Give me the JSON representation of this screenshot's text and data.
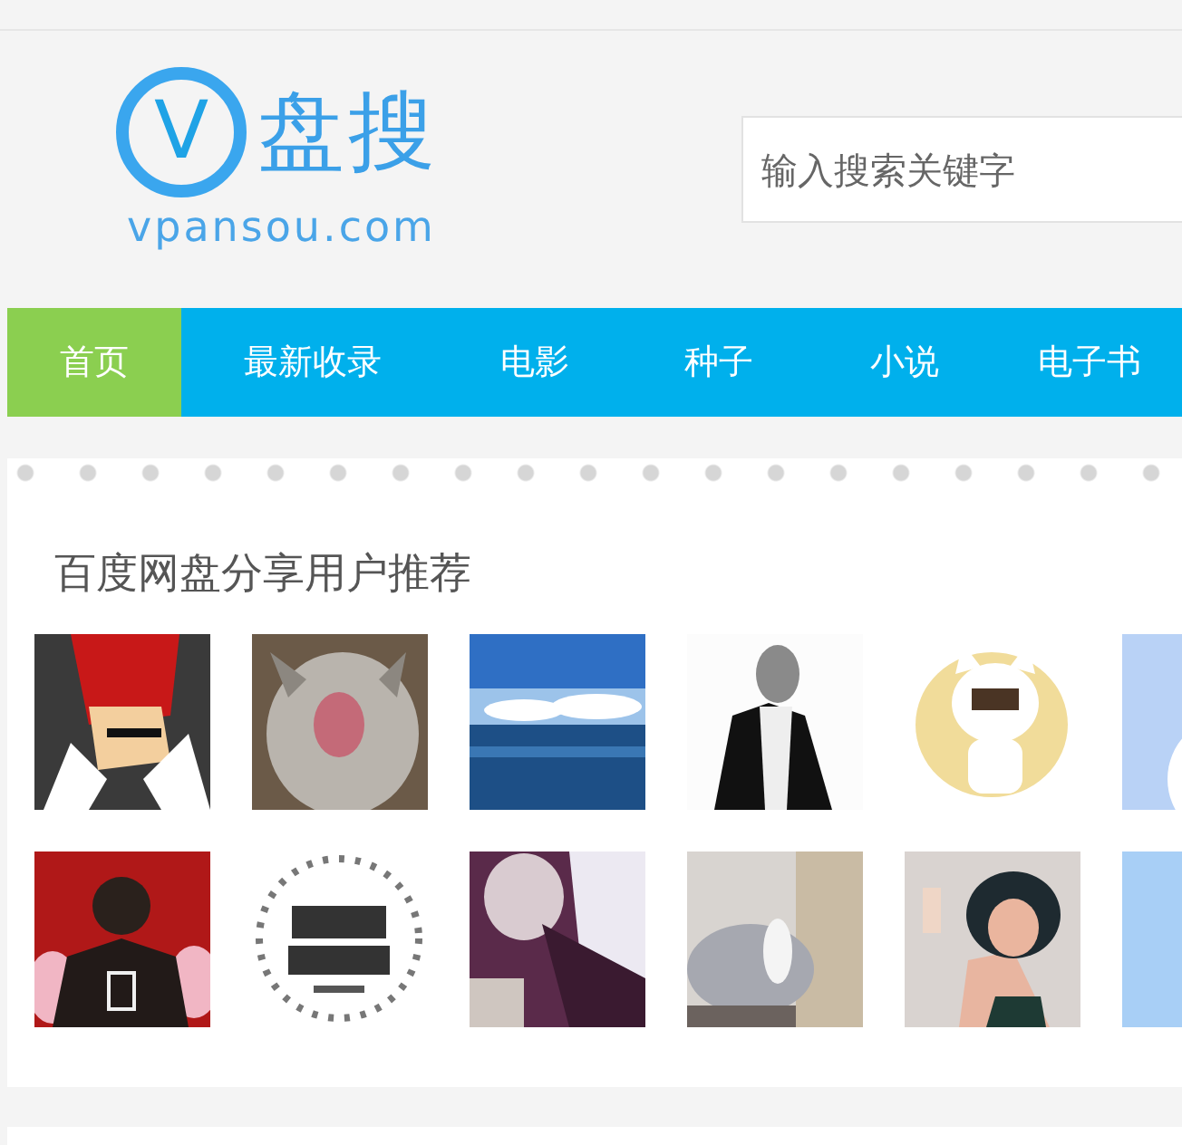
{
  "logo": {
    "mark": "V",
    "name": "盘搜",
    "domain": "vpansou.com"
  },
  "search": {
    "placeholder": "输入搜索关键字"
  },
  "nav": [
    {
      "label": "首页",
      "selected": true
    },
    {
      "label": "最新收录",
      "selected": false
    },
    {
      "label": "电影",
      "selected": false
    },
    {
      "label": "种子",
      "selected": false
    },
    {
      "label": "小说",
      "selected": false
    },
    {
      "label": "电子书",
      "selected": false
    }
  ],
  "section": {
    "title": "百度网盘分享用户推荐"
  }
}
